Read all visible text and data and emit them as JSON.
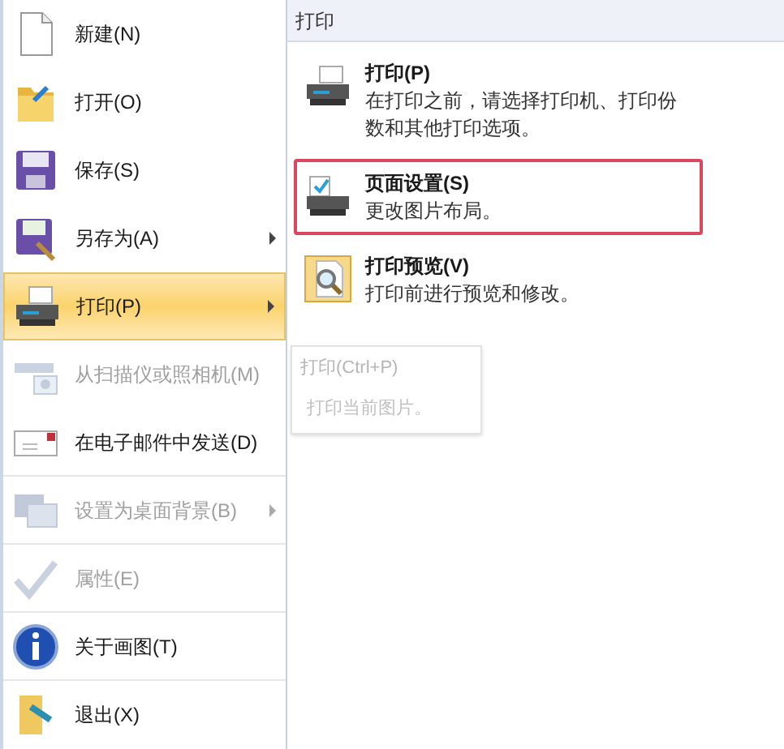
{
  "menu": [
    {
      "label": "新建(N)",
      "kind": "document",
      "disabled": false,
      "submenu": false,
      "selected": false,
      "divider_after": false
    },
    {
      "label": "打开(O)",
      "kind": "folder",
      "disabled": false,
      "submenu": false,
      "selected": false,
      "divider_after": false
    },
    {
      "label": "保存(S)",
      "kind": "floppy",
      "disabled": false,
      "submenu": false,
      "selected": false,
      "divider_after": false
    },
    {
      "label": "另存为(A)",
      "kind": "floppy-pen",
      "disabled": false,
      "submenu": true,
      "selected": false,
      "divider_after": false
    },
    {
      "label": "打印(P)",
      "kind": "printer",
      "disabled": false,
      "submenu": true,
      "selected": true,
      "divider_after": false
    },
    {
      "label": "从扫描仪或照相机(M)",
      "kind": "scanner",
      "disabled": true,
      "submenu": false,
      "selected": false,
      "divider_after": false
    },
    {
      "label": "在电子邮件中发送(D)",
      "kind": "mail",
      "disabled": false,
      "submenu": false,
      "selected": false,
      "divider_after": true
    },
    {
      "label": "设置为桌面背景(B)",
      "kind": "desktop",
      "disabled": true,
      "submenu": true,
      "selected": false,
      "divider_after": true
    },
    {
      "label": "属性(E)",
      "kind": "check",
      "disabled": true,
      "submenu": false,
      "selected": false,
      "divider_after": true
    },
    {
      "label": "关于画图(T)",
      "kind": "info",
      "disabled": false,
      "submenu": false,
      "selected": false,
      "divider_after": true
    },
    {
      "label": "退出(X)",
      "kind": "exit",
      "disabled": false,
      "submenu": false,
      "selected": false,
      "divider_after": false
    }
  ],
  "tooltip": {
    "title": "打印(Ctrl+P)",
    "text": "打印当前图片。"
  },
  "submenu": {
    "title": "打印",
    "items": [
      {
        "label": "打印(P)",
        "description": "在打印之前，请选择打印机、打印份数和其他打印选项。",
        "kind": "printer",
        "highlighted": false
      },
      {
        "label": "页面设置(S)",
        "description": "更改图片布局。",
        "kind": "page-setup",
        "highlighted": true
      },
      {
        "label": "打印预览(V)",
        "description": "打印前进行预览和修改。",
        "kind": "preview",
        "highlighted": false
      }
    ]
  }
}
